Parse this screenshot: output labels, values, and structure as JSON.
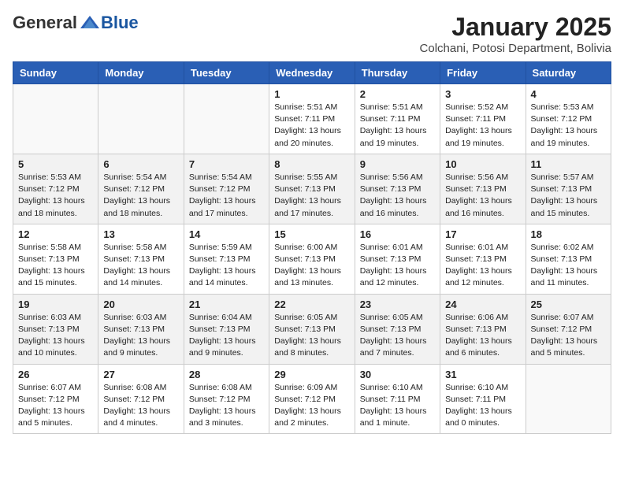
{
  "header": {
    "logo_general": "General",
    "logo_blue": "Blue",
    "title": "January 2025",
    "subtitle": "Colchani, Potosi Department, Bolivia"
  },
  "days_of_week": [
    "Sunday",
    "Monday",
    "Tuesday",
    "Wednesday",
    "Thursday",
    "Friday",
    "Saturday"
  ],
  "weeks": [
    {
      "shaded": false,
      "days": [
        {
          "num": "",
          "detail": ""
        },
        {
          "num": "",
          "detail": ""
        },
        {
          "num": "",
          "detail": ""
        },
        {
          "num": "1",
          "detail": "Sunrise: 5:51 AM\nSunset: 7:11 PM\nDaylight: 13 hours\nand 20 minutes."
        },
        {
          "num": "2",
          "detail": "Sunrise: 5:51 AM\nSunset: 7:11 PM\nDaylight: 13 hours\nand 19 minutes."
        },
        {
          "num": "3",
          "detail": "Sunrise: 5:52 AM\nSunset: 7:11 PM\nDaylight: 13 hours\nand 19 minutes."
        },
        {
          "num": "4",
          "detail": "Sunrise: 5:53 AM\nSunset: 7:12 PM\nDaylight: 13 hours\nand 19 minutes."
        }
      ]
    },
    {
      "shaded": true,
      "days": [
        {
          "num": "5",
          "detail": "Sunrise: 5:53 AM\nSunset: 7:12 PM\nDaylight: 13 hours\nand 18 minutes."
        },
        {
          "num": "6",
          "detail": "Sunrise: 5:54 AM\nSunset: 7:12 PM\nDaylight: 13 hours\nand 18 minutes."
        },
        {
          "num": "7",
          "detail": "Sunrise: 5:54 AM\nSunset: 7:12 PM\nDaylight: 13 hours\nand 17 minutes."
        },
        {
          "num": "8",
          "detail": "Sunrise: 5:55 AM\nSunset: 7:13 PM\nDaylight: 13 hours\nand 17 minutes."
        },
        {
          "num": "9",
          "detail": "Sunrise: 5:56 AM\nSunset: 7:13 PM\nDaylight: 13 hours\nand 16 minutes."
        },
        {
          "num": "10",
          "detail": "Sunrise: 5:56 AM\nSunset: 7:13 PM\nDaylight: 13 hours\nand 16 minutes."
        },
        {
          "num": "11",
          "detail": "Sunrise: 5:57 AM\nSunset: 7:13 PM\nDaylight: 13 hours\nand 15 minutes."
        }
      ]
    },
    {
      "shaded": false,
      "days": [
        {
          "num": "12",
          "detail": "Sunrise: 5:58 AM\nSunset: 7:13 PM\nDaylight: 13 hours\nand 15 minutes."
        },
        {
          "num": "13",
          "detail": "Sunrise: 5:58 AM\nSunset: 7:13 PM\nDaylight: 13 hours\nand 14 minutes."
        },
        {
          "num": "14",
          "detail": "Sunrise: 5:59 AM\nSunset: 7:13 PM\nDaylight: 13 hours\nand 14 minutes."
        },
        {
          "num": "15",
          "detail": "Sunrise: 6:00 AM\nSunset: 7:13 PM\nDaylight: 13 hours\nand 13 minutes."
        },
        {
          "num": "16",
          "detail": "Sunrise: 6:01 AM\nSunset: 7:13 PM\nDaylight: 13 hours\nand 12 minutes."
        },
        {
          "num": "17",
          "detail": "Sunrise: 6:01 AM\nSunset: 7:13 PM\nDaylight: 13 hours\nand 12 minutes."
        },
        {
          "num": "18",
          "detail": "Sunrise: 6:02 AM\nSunset: 7:13 PM\nDaylight: 13 hours\nand 11 minutes."
        }
      ]
    },
    {
      "shaded": true,
      "days": [
        {
          "num": "19",
          "detail": "Sunrise: 6:03 AM\nSunset: 7:13 PM\nDaylight: 13 hours\nand 10 minutes."
        },
        {
          "num": "20",
          "detail": "Sunrise: 6:03 AM\nSunset: 7:13 PM\nDaylight: 13 hours\nand 9 minutes."
        },
        {
          "num": "21",
          "detail": "Sunrise: 6:04 AM\nSunset: 7:13 PM\nDaylight: 13 hours\nand 9 minutes."
        },
        {
          "num": "22",
          "detail": "Sunrise: 6:05 AM\nSunset: 7:13 PM\nDaylight: 13 hours\nand 8 minutes."
        },
        {
          "num": "23",
          "detail": "Sunrise: 6:05 AM\nSunset: 7:13 PM\nDaylight: 13 hours\nand 7 minutes."
        },
        {
          "num": "24",
          "detail": "Sunrise: 6:06 AM\nSunset: 7:13 PM\nDaylight: 13 hours\nand 6 minutes."
        },
        {
          "num": "25",
          "detail": "Sunrise: 6:07 AM\nSunset: 7:12 PM\nDaylight: 13 hours\nand 5 minutes."
        }
      ]
    },
    {
      "shaded": false,
      "days": [
        {
          "num": "26",
          "detail": "Sunrise: 6:07 AM\nSunset: 7:12 PM\nDaylight: 13 hours\nand 5 minutes."
        },
        {
          "num": "27",
          "detail": "Sunrise: 6:08 AM\nSunset: 7:12 PM\nDaylight: 13 hours\nand 4 minutes."
        },
        {
          "num": "28",
          "detail": "Sunrise: 6:08 AM\nSunset: 7:12 PM\nDaylight: 13 hours\nand 3 minutes."
        },
        {
          "num": "29",
          "detail": "Sunrise: 6:09 AM\nSunset: 7:12 PM\nDaylight: 13 hours\nand 2 minutes."
        },
        {
          "num": "30",
          "detail": "Sunrise: 6:10 AM\nSunset: 7:11 PM\nDaylight: 13 hours\nand 1 minute."
        },
        {
          "num": "31",
          "detail": "Sunrise: 6:10 AM\nSunset: 7:11 PM\nDaylight: 13 hours\nand 0 minutes."
        },
        {
          "num": "",
          "detail": ""
        }
      ]
    }
  ]
}
